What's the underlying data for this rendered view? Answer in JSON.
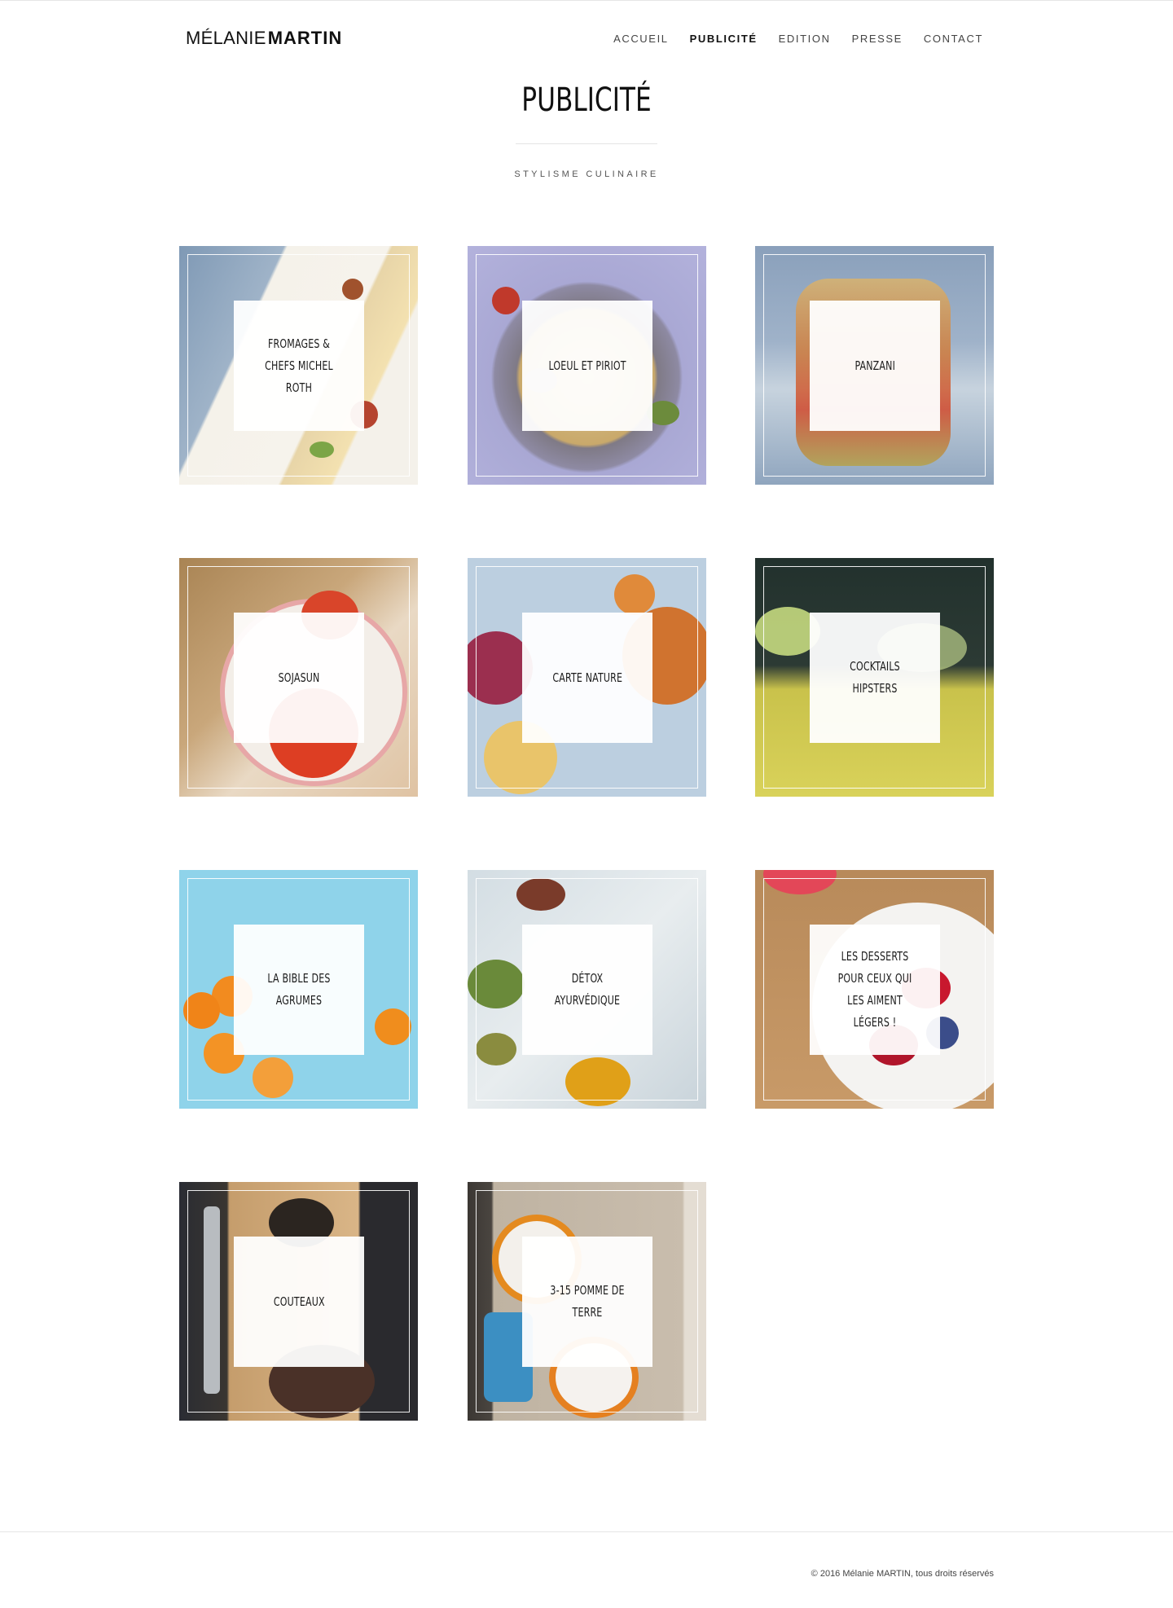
{
  "header": {
    "logo_first": "MÉLANIE",
    "logo_last": "MARTIN",
    "nav": [
      {
        "label": "ACCUEIL",
        "active": false
      },
      {
        "label": "PUBLICITÉ",
        "active": true
      },
      {
        "label": "EDITION",
        "active": false
      },
      {
        "label": "PRESSE",
        "active": false
      },
      {
        "label": "CONTACT",
        "active": false
      }
    ]
  },
  "page": {
    "title": "PUBLICITÉ",
    "subtitle": "STYLISME CULINAIRE"
  },
  "projects": [
    {
      "title": "FROMAGES & CHEFS MICHEL ROTH",
      "image": "plated-cheese-dish"
    },
    {
      "title": "LOEUL ET PIRIOT",
      "image": "pasta-pan"
    },
    {
      "title": "PANZANI",
      "image": "gratin-jar"
    },
    {
      "title": "SOJASUN",
      "image": "stuffed-tomatoes"
    },
    {
      "title": "CARTE NATURE",
      "image": "vegetable-spread"
    },
    {
      "title": "COCKTAILS HIPSTERS",
      "image": "cocktail-glasses"
    },
    {
      "title": "LA BIBLE DES AGRUMES",
      "image": "kumquats"
    },
    {
      "title": "DÉTOX AYURVÉDIQUE",
      "image": "spices"
    },
    {
      "title": "LES DESSERTS POUR CEUX QUI LES AIMENT LÉGERS !",
      "image": "berries-plate"
    },
    {
      "title": "COUTEAUX",
      "image": "knife-steak"
    },
    {
      "title": "3-15 POMME DE TERRE",
      "image": "soup-bowls"
    }
  ],
  "footer": {
    "copyright": "© 2016 Mélanie MARTIN, tous droits réservés"
  }
}
